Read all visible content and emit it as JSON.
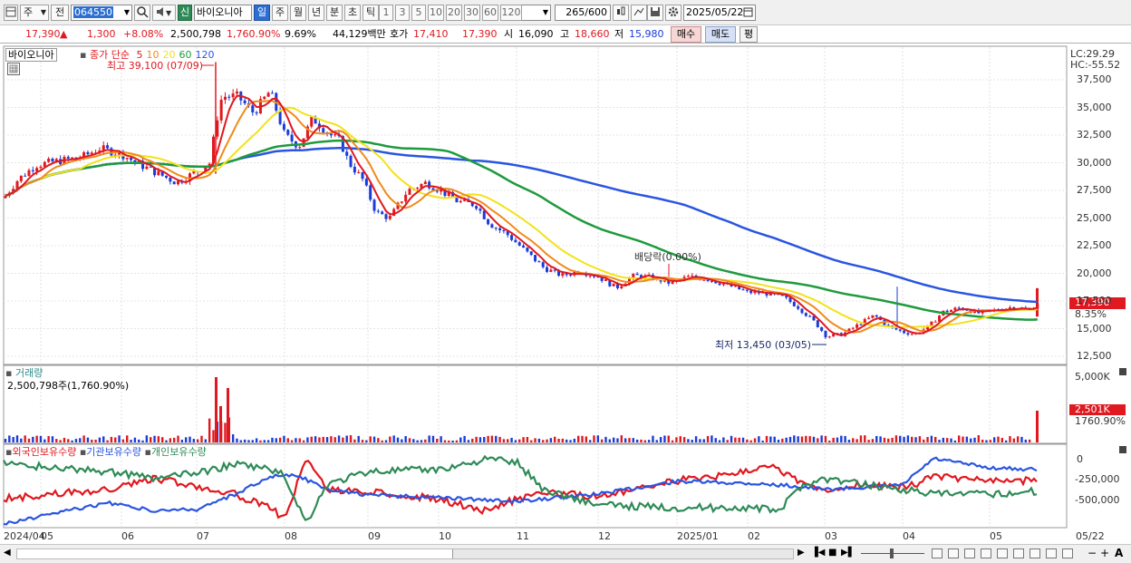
{
  "toolbar": {
    "market": "주",
    "prev_label": "전",
    "code": "064550",
    "shin": "신",
    "name": "바이오니아",
    "periods": [
      "일",
      "주",
      "월",
      "년",
      "분",
      "초",
      "틱"
    ],
    "active_period": "일",
    "minutes": [
      "1",
      "3",
      "5",
      "10",
      "20",
      "30",
      "60",
      "120"
    ],
    "count": "265",
    "count_total": "/600",
    "date": "2025/05/22"
  },
  "quote": {
    "price": "17,390",
    "arrow": "▲",
    "change": "1,300",
    "change_pct": "+8.08%",
    "volume": "2,500,798",
    "volume_pct": "1,760.90%",
    "turnover": "9.69%",
    "amount": "44,129백만",
    "hoga_label": "호가",
    "ask": "17,410",
    "bid": "17,390",
    "open_label": "시",
    "open": "16,090",
    "high_label": "고",
    "high": "18,660",
    "low_label": "저",
    "low": "15,980",
    "buy_button": "매수",
    "sell_button": "매도",
    "eval_button": "평"
  },
  "price_pane": {
    "title": "바이오니아",
    "ma_label": "종가 단순",
    "ma_periods": [
      "5",
      "10",
      "20",
      "60",
      "120"
    ],
    "ma_colors": [
      "#e0181f",
      "#f08a1c",
      "#f2e21a",
      "#1e9a3c",
      "#2a55e0"
    ],
    "high_annotation": "최고 39,100 (07/09)",
    "low_annotation": "최저 13,450 (03/05)",
    "dividend_annotation": "배당락(0.00%)",
    "lc": "LC:29.29",
    "hc": "HC:-55.52",
    "current_tag": "17,390",
    "current_pct": "8.35%",
    "y_ticks": [
      "37,500",
      "35,000",
      "32,500",
      "30,000",
      "27,500",
      "25,000",
      "22,500",
      "20,000",
      "17,500",
      "15,000",
      "12,500"
    ]
  },
  "volume_pane": {
    "title": "거래량",
    "value_label": "2,500,798주(1,760.90%)",
    "y_tick": "5,000K",
    "current_tag": "2,501K",
    "current_pct": "1760.90%"
  },
  "holding_pane": {
    "series": [
      "외국인보유수량",
      "기관보유수량",
      "개인보유수량"
    ],
    "colors": [
      "#e0181f",
      "#2a55e0",
      "#2e8a57"
    ],
    "y_ticks": [
      "0",
      "-250,000",
      "-500,000"
    ]
  },
  "x_axis": [
    "2024/04",
    "05",
    "06",
    "07",
    "08",
    "09",
    "10",
    "11",
    "12",
    "2025/01",
    "02",
    "03",
    "04",
    "05",
    "05/22"
  ],
  "chart_data": [
    {
      "type": "line",
      "title": "바이오니아",
      "x": [
        "2024/04",
        "05",
        "06",
        "07",
        "08",
        "09",
        "10",
        "11",
        "12",
        "2025/01",
        "02",
        "03",
        "04",
        "05",
        "05/22"
      ],
      "series": [
        {
          "name": "5",
          "values": [
            27000,
            30000,
            31200,
            29200,
            33500,
            30000,
            27500,
            23500,
            20000,
            19500,
            18000,
            14200,
            14500,
            16500,
            17390
          ]
        },
        {
          "name": "120",
          "values": [
            29500,
            29400,
            29300,
            29200,
            29900,
            30800,
            30200,
            28500,
            26500,
            24800,
            23000,
            20300,
            18400,
            17500,
            17400
          ]
        }
      ],
      "ylim": [
        12000,
        39500
      ],
      "high": 39100,
      "low": 13450
    },
    {
      "type": "bar",
      "title": "거래량",
      "latest": 2500798,
      "ylim": [
        0,
        5000000
      ]
    }
  ]
}
